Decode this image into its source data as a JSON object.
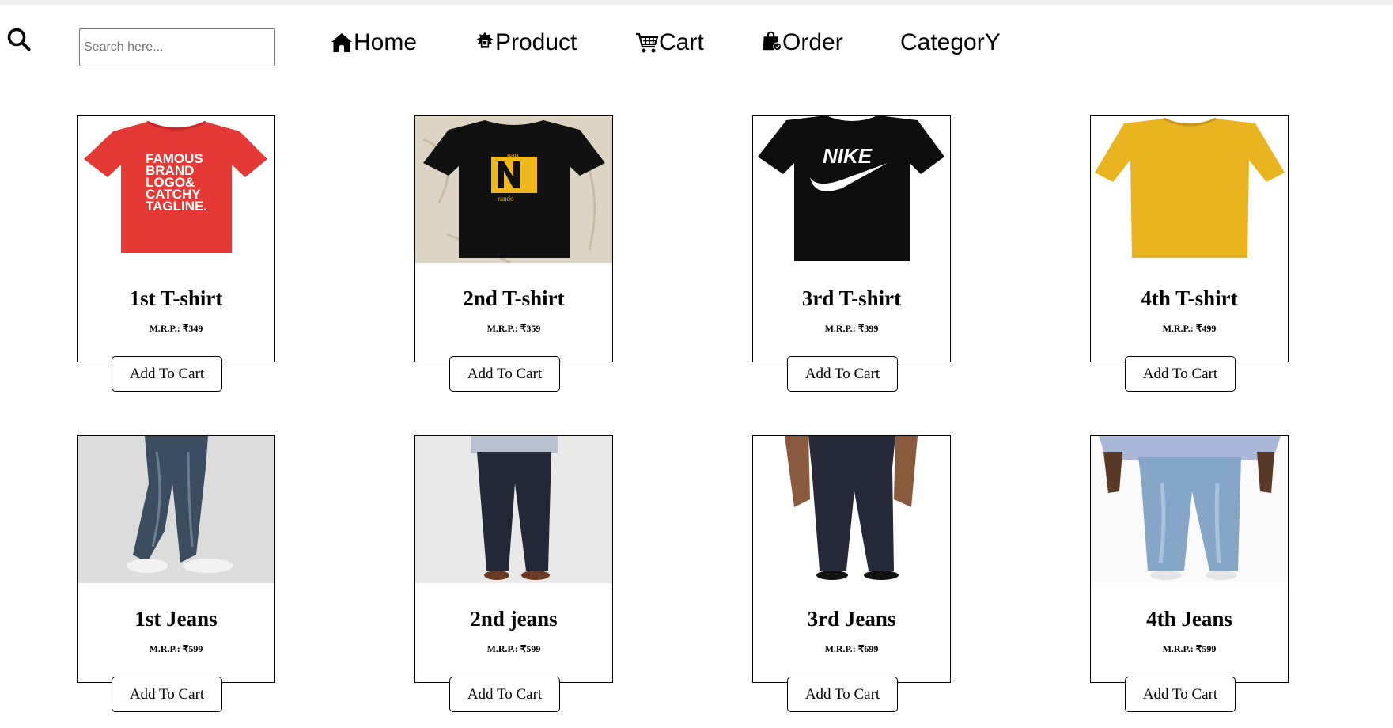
{
  "search": {
    "placeholder": "Search here...",
    "value": ""
  },
  "nav": {
    "items": [
      {
        "label": "Home",
        "icon": "home-icon"
      },
      {
        "label": "Product",
        "icon": "product-icon"
      },
      {
        "label": "Cart",
        "icon": "cart-icon"
      },
      {
        "label": "Order",
        "icon": "shopping-bag-icon"
      },
      {
        "label": "CategorY",
        "icon": ""
      }
    ]
  },
  "products": [
    {
      "name": "1st T-shirt",
      "price": "M.R.P.: ₹349",
      "button": "Add To Cart",
      "color": "#e53935"
    },
    {
      "name": "2nd T-shirt",
      "price": "M.R.P.: ₹359",
      "button": "Add To Cart",
      "color": "#111111"
    },
    {
      "name": "3rd T-shirt",
      "price": "M.R.P.: ₹399",
      "button": "Add To Cart",
      "color": "#0d0d0d"
    },
    {
      "name": "4th T-shirt",
      "price": "M.R.P.: ₹499",
      "button": "Add To Cart",
      "color": "#eab320"
    },
    {
      "name": "1st Jeans",
      "price": "M.R.P.: ₹599",
      "button": "Add To Cart",
      "color": "#3b4d60"
    },
    {
      "name": "2nd jeans",
      "price": "M.R.P.: ₹599",
      "button": "Add To Cart",
      "color": "#232838"
    },
    {
      "name": "3rd Jeans",
      "price": "M.R.P.: ₹699",
      "button": "Add To Cart",
      "color": "#26293a"
    },
    {
      "name": "4th Jeans",
      "price": "M.R.P.: ₹599",
      "button": "Add To Cart",
      "color": "#86a6c8"
    }
  ],
  "image_text": {
    "tshirt1": [
      "FAMOUS",
      "BRAND",
      "LOGO&",
      "CATCHY",
      "TAGLINE."
    ],
    "tshirt2_top": "nan",
    "tshirt2_bottom": "rando",
    "tshirt3": "NIKE"
  }
}
